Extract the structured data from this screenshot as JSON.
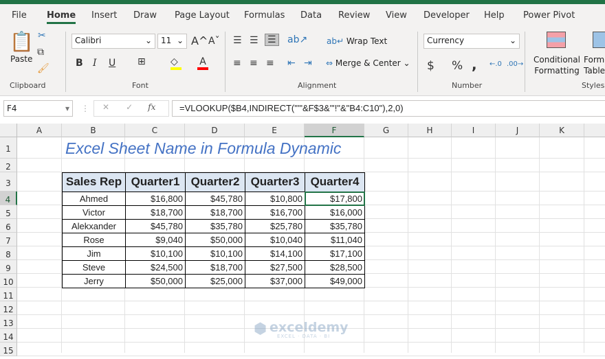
{
  "ribbon": {
    "tabs": [
      "File",
      "Home",
      "Insert",
      "Draw",
      "Page Layout",
      "Formulas",
      "Data",
      "Review",
      "View",
      "Developer",
      "Help",
      "Power Pivot"
    ],
    "active_tab": "Home",
    "clipboard": {
      "paste": "Paste",
      "group": "Clipboard"
    },
    "font": {
      "name": "Calibri",
      "size": "11",
      "group": "Font",
      "bold": "B",
      "italic": "I",
      "underline": "U",
      "highlight_color": "#ffff00",
      "font_color": "#ff0000"
    },
    "alignment": {
      "wrap_text": "Wrap Text",
      "merge_center": "Merge & Center",
      "group": "Alignment"
    },
    "number": {
      "format": "Currency",
      "currency": "$",
      "percent": "%",
      "comma": ",",
      "group": "Number"
    },
    "styles": {
      "conditional_formatting_1": "Conditional",
      "conditional_formatting_2": "Formatting",
      "format_table_1": "Format as",
      "format_table_2": "Table",
      "group": "Styles"
    }
  },
  "formula_bar": {
    "name_box": "F4",
    "formula": "=VLOOKUP($B4,INDIRECT(\"'\"&F$3&\"'!\"&\"B4:C10\"),2,0)",
    "fx": "fx"
  },
  "columns": [
    "A",
    "B",
    "C",
    "D",
    "E",
    "F",
    "G",
    "H",
    "I",
    "J",
    "K"
  ],
  "selected_column": "F",
  "selected_row": "4",
  "rows": [
    "1",
    "2",
    "3",
    "4",
    "5",
    "6",
    "7",
    "8",
    "9",
    "10",
    "11",
    "12",
    "13",
    "14",
    "15"
  ],
  "sheet": {
    "title": "Excel Sheet Name in Formula Dynamic",
    "title_color": "#4472c4",
    "table": {
      "headers": [
        "Sales Rep",
        "Quarter1",
        "Quarter2",
        "Quarter3",
        "Quarter4"
      ],
      "rows": [
        [
          "Ahmed",
          "$16,800",
          "$45,780",
          "$10,800",
          "$17,800"
        ],
        [
          "Victor",
          "$18,700",
          "$18,700",
          "$16,700",
          "$16,000"
        ],
        [
          "Alekxander",
          "$45,780",
          "$35,780",
          "$25,780",
          "$35,780"
        ],
        [
          "Rose",
          "$9,040",
          "$50,000",
          "$10,040",
          "$11,040"
        ],
        [
          "Jim",
          "$10,100",
          "$10,100",
          "$14,100",
          "$17,100"
        ],
        [
          "Steve",
          "$24,500",
          "$18,700",
          "$27,500",
          "$28,500"
        ],
        [
          "Jerry",
          "$50,000",
          "$25,000",
          "$37,000",
          "$49,000"
        ]
      ]
    }
  },
  "watermark": {
    "name": "exceldemy",
    "tagline": "EXCEL · DATA · BI"
  }
}
